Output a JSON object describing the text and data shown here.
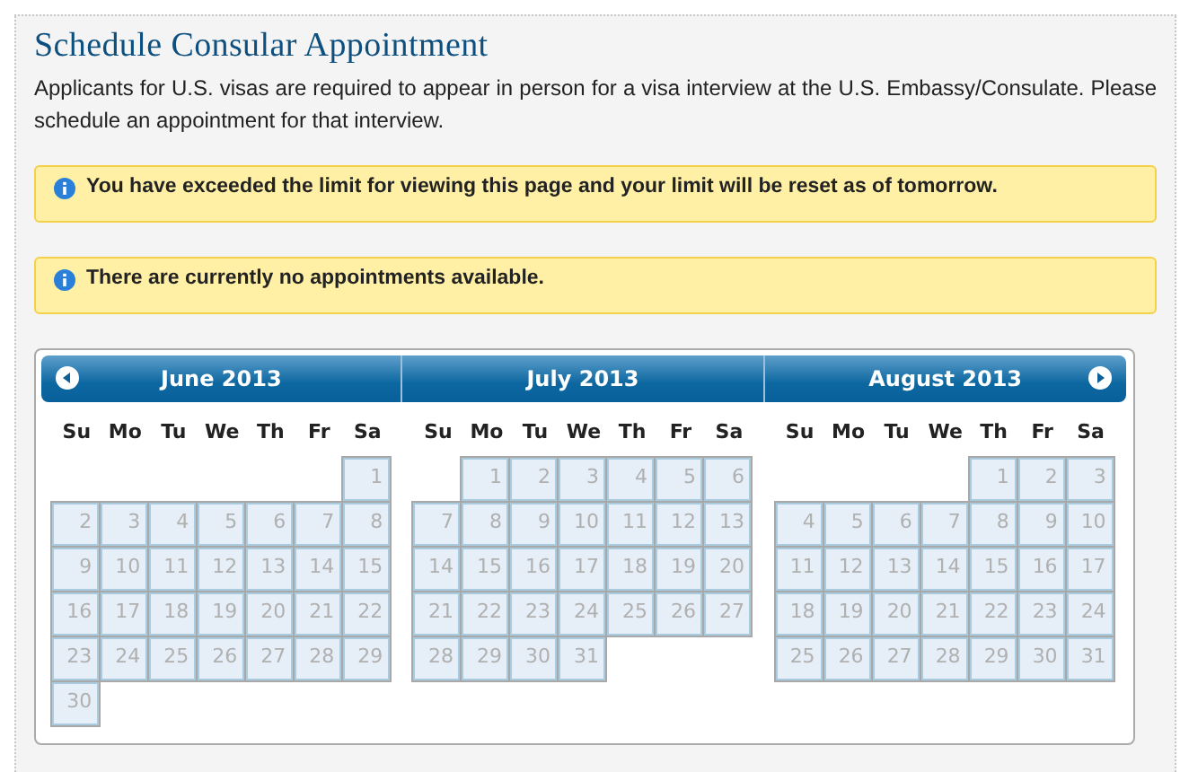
{
  "title": "Schedule Consular Appointment",
  "intro": "Applicants for U.S. visas are required to appear in person for a visa interview at the U.S. Embassy/Consulate. Please schedule an appointment for that interview.",
  "alerts": [
    "You have exceeded the limit for viewing this page and your limit will be reset as of tomorrow.",
    "There are currently no appointments available."
  ],
  "calendar": {
    "months": [
      {
        "title": "June 2013",
        "kind": "first",
        "disabled": true,
        "weekdays": [
          "Su",
          "Mo",
          "Tu",
          "We",
          "Th",
          "Fr",
          "Sa"
        ],
        "weeks": [
          {
            "kind": "start",
            "days": [
              "1"
            ]
          },
          {
            "kind": "full",
            "days": [
              "2",
              "3",
              "4",
              "5",
              "6",
              "7",
              "8"
            ]
          },
          {
            "kind": "full",
            "days": [
              "9",
              "10",
              "11",
              "12",
              "13",
              "14",
              "15"
            ]
          },
          {
            "kind": "full",
            "days": [
              "16",
              "17",
              "18",
              "19",
              "20",
              "21",
              "22"
            ]
          },
          {
            "kind": "full",
            "days": [
              "23",
              "24",
              "25",
              "26",
              "27",
              "28",
              "29"
            ]
          },
          {
            "kind": "end",
            "days": [
              "30"
            ]
          }
        ]
      },
      {
        "title": "July 2013",
        "kind": "middle",
        "disabled": true,
        "weekdays": [
          "Su",
          "Mo",
          "Tu",
          "We",
          "Th",
          "Fr",
          "Sa"
        ],
        "weeks": [
          {
            "kind": "start",
            "days": [
              "1",
              "2",
              "3",
              "4",
              "5",
              "6"
            ]
          },
          {
            "kind": "full",
            "days": [
              "7",
              "8",
              "9",
              "10",
              "11",
              "12",
              "13"
            ]
          },
          {
            "kind": "full",
            "days": [
              "14",
              "15",
              "16",
              "17",
              "18",
              "19",
              "20"
            ]
          },
          {
            "kind": "full",
            "days": [
              "21",
              "22",
              "23",
              "24",
              "25",
              "26",
              "27"
            ]
          },
          {
            "kind": "end",
            "days": [
              "28",
              "29",
              "30",
              "31"
            ]
          }
        ]
      },
      {
        "title": "August 2013",
        "kind": "last",
        "disabled": true,
        "weekdays": [
          "Su",
          "Mo",
          "Tu",
          "We",
          "Th",
          "Fr",
          "Sa"
        ],
        "weeks": [
          {
            "kind": "start",
            "days": [
              "1",
              "2",
              "3"
            ]
          },
          {
            "kind": "full",
            "days": [
              "4",
              "5",
              "6",
              "7",
              "8",
              "9",
              "10"
            ]
          },
          {
            "kind": "full",
            "days": [
              "11",
              "12",
              "13",
              "14",
              "15",
              "16",
              "17"
            ]
          },
          {
            "kind": "full",
            "days": [
              "18",
              "19",
              "20",
              "21",
              "22",
              "23",
              "24"
            ]
          },
          {
            "kind": "full",
            "days": [
              "25",
              "26",
              "27",
              "28",
              "29",
              "30",
              "31"
            ]
          }
        ]
      }
    ]
  }
}
